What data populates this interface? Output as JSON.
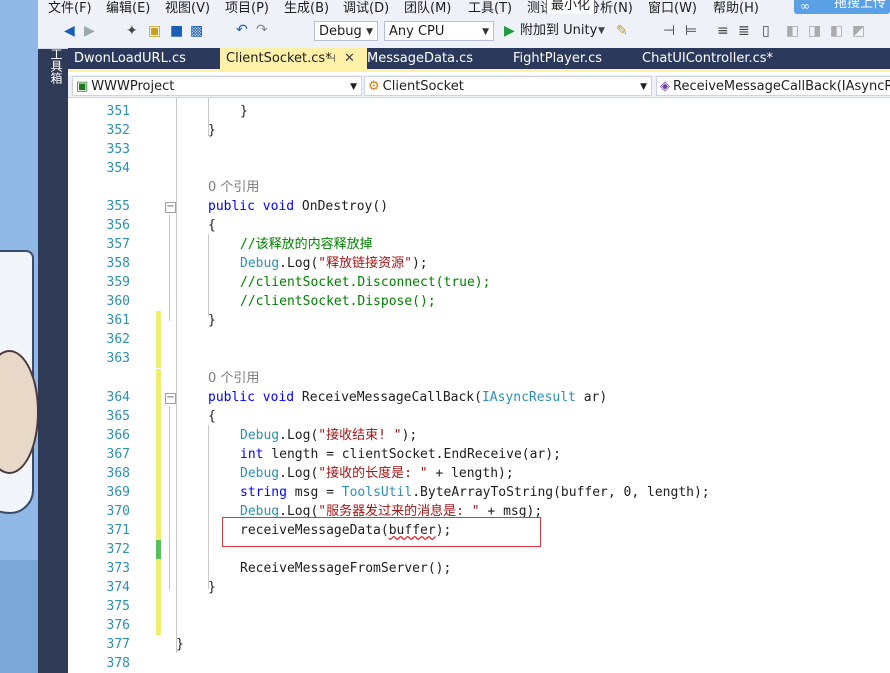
{
  "menu": [
    "文件(F)",
    "编辑(E)",
    "视图(V)",
    "项目(P)",
    "生成(B)",
    "调试(D)",
    "团队(M)",
    "工具(T)",
    "测试(S)",
    "分析(N)",
    "窗口(W)",
    "帮助(H)"
  ],
  "tooltip": "最小化",
  "upload_button": "拖搜上传",
  "toolbar": {
    "config": "Debug",
    "platform": "Any CPU",
    "attach": "附加到 Unity"
  },
  "toolbox_label": "工具箱",
  "tabs": [
    "DwonLoadURL.cs",
    "ClientSocket.cs*",
    "MessageData.cs",
    "FightPlayer.cs",
    "ChatUIController.cs*"
  ],
  "active_tab_index": 1,
  "nav": {
    "project": "WWWProject",
    "class": "ClientSocket",
    "member": "ReceiveMessageCallBack(IAsyncResult ar)"
  },
  "editor": {
    "ref_text": "0 个引用",
    "lines": [
      {
        "n": "351",
        "code": "}"
      },
      {
        "n": "352",
        "code": "}"
      },
      {
        "n": "353",
        "code": ""
      },
      {
        "n": "354",
        "code": ""
      },
      {
        "n": "355",
        "code": "public void OnDestroy()"
      },
      {
        "n": "356",
        "code": "{"
      },
      {
        "n": "357",
        "code": "//该释放的内容释放掉"
      },
      {
        "n": "358",
        "code": "Debug.Log(\"释放链接资源\");"
      },
      {
        "n": "359",
        "code": "//clientSocket.Disconnect(true);"
      },
      {
        "n": "360",
        "code": "//clientSocket.Dispose();"
      },
      {
        "n": "361",
        "code": "}"
      },
      {
        "n": "362",
        "code": ""
      },
      {
        "n": "363",
        "code": ""
      },
      {
        "n": "364",
        "code": "public void ReceiveMessageCallBack(IAsyncResult ar)"
      },
      {
        "n": "365",
        "code": "{"
      },
      {
        "n": "366",
        "code": "Debug.Log(\"接收结束! \");"
      },
      {
        "n": "367",
        "code": "int length = clientSocket.EndReceive(ar);"
      },
      {
        "n": "368",
        "code": "Debug.Log(\"接收的长度是: \" + length);"
      },
      {
        "n": "369",
        "code": "string msg = ToolsUtil.ByteArrayToString(buffer, 0, length);"
      },
      {
        "n": "370",
        "code": "Debug.Log(\"服务器发过来的消息是: \" + msg);"
      },
      {
        "n": "371",
        "code": "receiveMessageData(buffer);"
      },
      {
        "n": "372",
        "code": ""
      },
      {
        "n": "373",
        "code": "ReceiveMessageFromServer();"
      },
      {
        "n": "374",
        "code": "}"
      },
      {
        "n": "375",
        "code": ""
      },
      {
        "n": "376",
        "code": ""
      },
      {
        "n": "377",
        "code": "}"
      },
      {
        "n": "378",
        "code": ""
      }
    ]
  },
  "colors": {
    "keyword": "#0000ff",
    "comment": "#008000",
    "string": "#a31515",
    "type": "#2b91af",
    "changed_unsaved": "#efef6f",
    "changed_saved": "#57c25a",
    "highlight_box": "#d9353a"
  }
}
